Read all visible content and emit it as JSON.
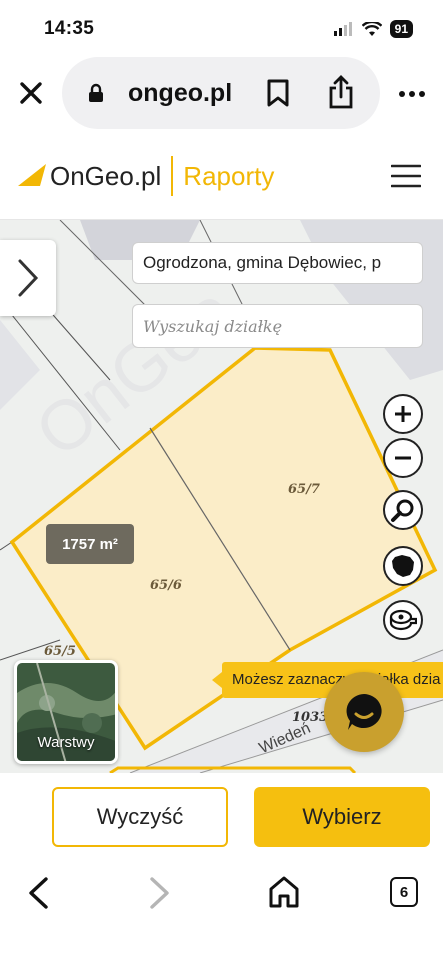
{
  "status": {
    "time": "14:35",
    "battery": "91"
  },
  "browser": {
    "url": "ongeo.pl"
  },
  "header": {
    "brand": "OnGeo.pl",
    "section": "Raporty"
  },
  "map": {
    "location": "Ogrodzona, gmina Dębowiec, p",
    "search_placeholder": "Wyszukaj działkę",
    "area_badge": "1757 m²",
    "parcels": [
      "65/7",
      "65/6",
      "65/5",
      "1033"
    ],
    "road_label": "Wiedeń",
    "tooltip": "Możesz zaznaczyć działka dzia",
    "layers_label": "Warstwy"
  },
  "actions": {
    "clear": "Wyczyść",
    "select": "Wybierz"
  },
  "nav": {
    "tabs_count": "6"
  },
  "colors": {
    "accent": "#f2b705",
    "parcel_fill": "#fbedc8",
    "badge": "#6e6a5e",
    "chat": "#c9a02e"
  }
}
